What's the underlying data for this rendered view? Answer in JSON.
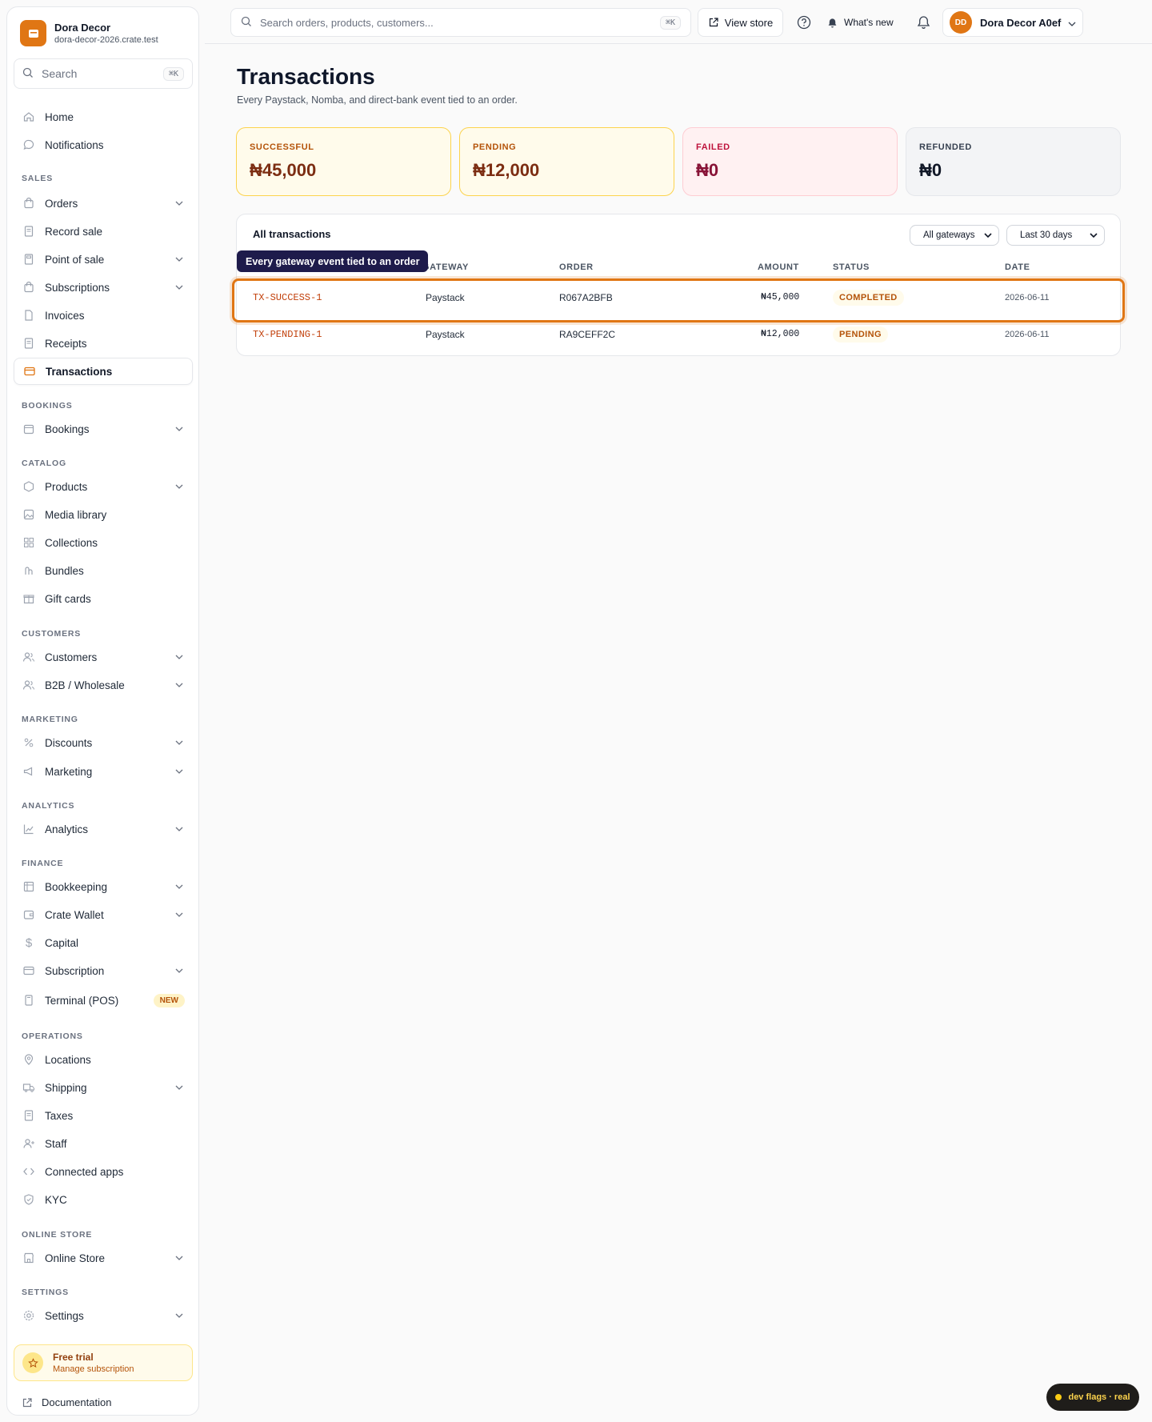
{
  "brand": {
    "name": "Dora Decor",
    "domain": "dora-decor-2026.crate.test"
  },
  "sidebar_search": {
    "label": "Search",
    "shortcut": "⌘K"
  },
  "nav": {
    "home": "Home",
    "notifications": "Notifications",
    "sales": "SALES",
    "orders": "Orders",
    "record_sale": "Record sale",
    "point_of_sale": "Point of sale",
    "subscriptions": "Subscriptions",
    "invoices": "Invoices",
    "receipts": "Receipts",
    "transactions": "Transactions",
    "bookings_section": "BOOKINGS",
    "bookings": "Bookings",
    "catalog": "CATALOG",
    "products": "Products",
    "media_library": "Media library",
    "collections": "Collections",
    "bundles": "Bundles",
    "gift_cards": "Gift cards",
    "customers_section": "CUSTOMERS",
    "customers": "Customers",
    "b2b": "B2B / Wholesale",
    "marketing_section": "MARKETING",
    "discounts": "Discounts",
    "marketing": "Marketing",
    "analytics_section": "ANALYTICS",
    "analytics": "Analytics",
    "finance": "FINANCE",
    "bookkeeping": "Bookkeeping",
    "crate_wallet": "Crate Wallet",
    "capital": "Capital",
    "subscription": "Subscription",
    "terminal": "Terminal (POS)",
    "terminal_badge": "NEW",
    "operations": "OPERATIONS",
    "locations": "Locations",
    "shipping": "Shipping",
    "taxes": "Taxes",
    "staff": "Staff",
    "connected_apps": "Connected apps",
    "kyc": "KYC",
    "online_store_section": "ONLINE STORE",
    "online_store": "Online Store",
    "settings_section": "SETTINGS",
    "settings": "Settings"
  },
  "trial": {
    "title": "Free trial",
    "subtitle": "Manage subscription"
  },
  "documentation": "Documentation",
  "topbar": {
    "search_placeholder": "Search orders, products, customers...",
    "search_shortcut": "⌘K",
    "view_store": "View store",
    "whats_new": "What's new",
    "user_initials": "DD",
    "user_name": "Dora Decor A0ef"
  },
  "page": {
    "title": "Transactions",
    "subtitle": "Every Paystack, Nomba, and direct-bank event tied to an order."
  },
  "stats": [
    {
      "label": "SUCCESSFUL",
      "value": "₦45,000"
    },
    {
      "label": "PENDING",
      "value": "₦12,000"
    },
    {
      "label": "FAILED",
      "value": "₦0"
    },
    {
      "label": "REFUNDED",
      "value": "₦0"
    }
  ],
  "transactions": {
    "title": "All transactions",
    "gateway_filter": "All gateways",
    "date_filter": "Last 30 days",
    "columns": {
      "gateway": "GATEWAY",
      "order": "ORDER",
      "amount": "AMOUNT",
      "status": "STATUS",
      "date": "DATE"
    },
    "rows": [
      {
        "ref": "TX-SUCCESS-1",
        "gateway": "Paystack",
        "order": "R067A2BFB",
        "amount": "₦45,000",
        "status": "COMPLETED",
        "date": "2026-06-11"
      },
      {
        "ref": "TX-PENDING-1",
        "gateway": "Paystack",
        "order": "RA9CEFF2C",
        "amount": "₦12,000",
        "status": "PENDING",
        "date": "2026-06-11"
      }
    ],
    "tooltip": "Every gateway event tied to an order"
  },
  "dev_flags": "dev flags · real",
  "colors": {
    "accent": "#e07614",
    "tooltip_bg": "#1e1b4b"
  }
}
